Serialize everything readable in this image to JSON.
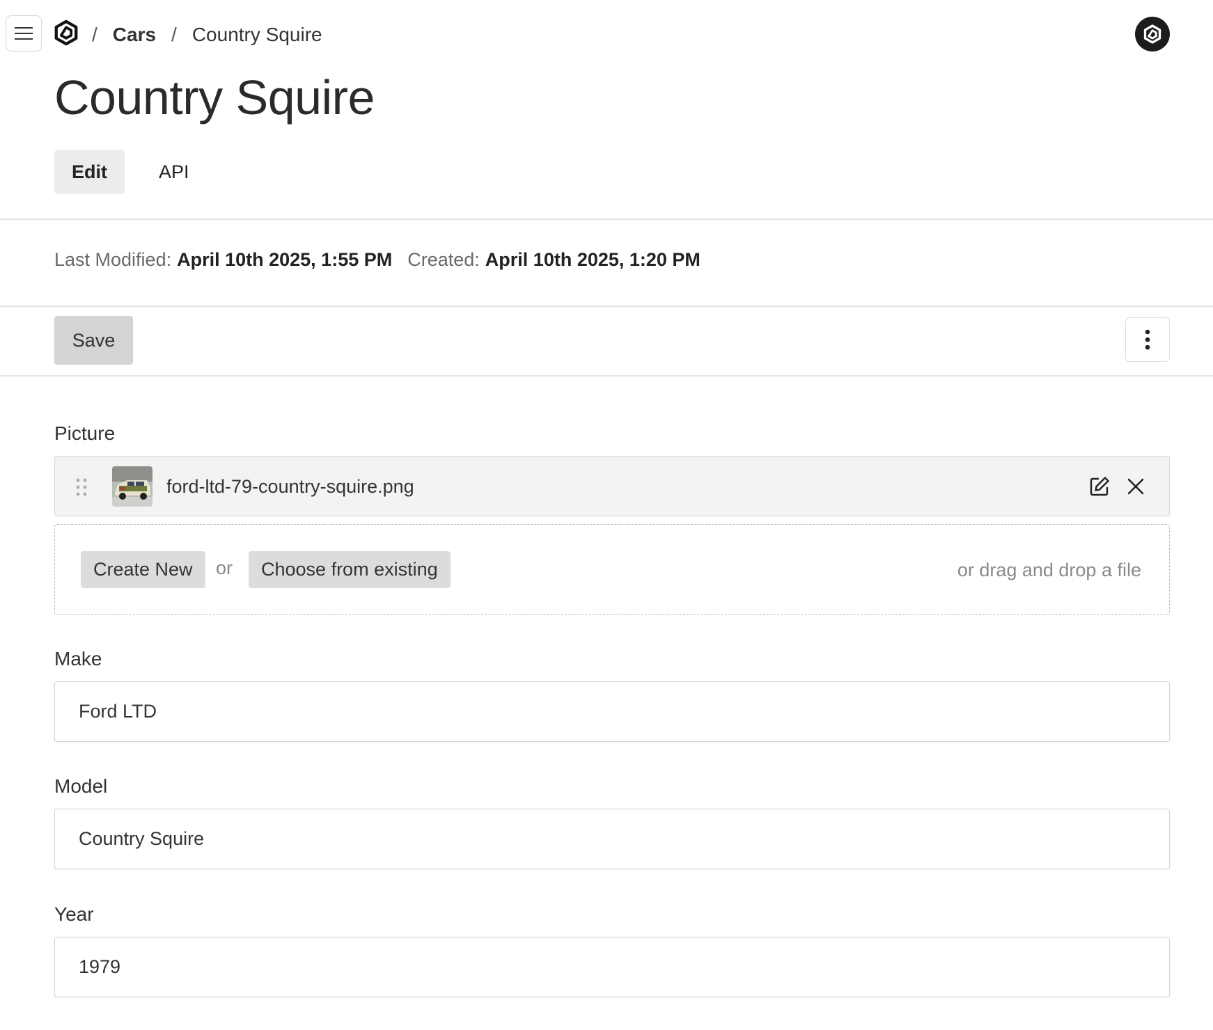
{
  "topbar": {
    "breadcrumbs": [
      "Cars",
      "Country Squire"
    ],
    "separator": "/",
    "icons": {
      "menu": "hamburger-icon",
      "logo": "brand-logo",
      "avatar": "user-avatar"
    }
  },
  "page": {
    "title": "Country Squire"
  },
  "tabs": [
    {
      "label": "Edit",
      "active": true
    },
    {
      "label": "API",
      "active": false
    }
  ],
  "meta": {
    "last_modified_label": "Last Modified:",
    "last_modified_value": "April 10th 2025, 1:55 PM",
    "created_label": "Created:",
    "created_value": "April 10th 2025, 1:20 PM"
  },
  "toolbar": {
    "save_label": "Save",
    "more_icon": "kebab-vertical-icon"
  },
  "form": {
    "picture": {
      "label": "Picture",
      "file_name": "ford-ltd-79-country-squire.png",
      "create_new_label": "Create New",
      "or_label": "or",
      "choose_existing_label": "Choose from existing",
      "drag_drop_label": "or drag and drop a file"
    },
    "make": {
      "label": "Make",
      "value": "Ford LTD"
    },
    "model": {
      "label": "Model",
      "value": "Country Squire"
    },
    "year": {
      "label": "Year",
      "value": "1979"
    }
  },
  "colors": {
    "active_tab_bg": "#ececec",
    "save_button_bg": "#d4d4d4",
    "picture_row_bg": "#f3f3f3",
    "avatar_bg": "#1c1c1c"
  }
}
